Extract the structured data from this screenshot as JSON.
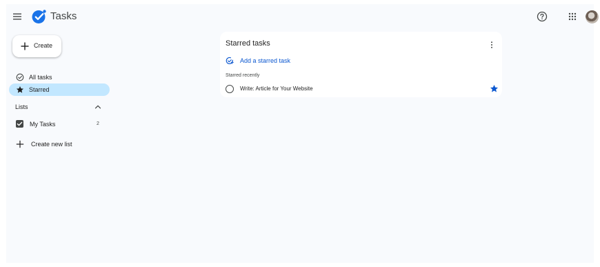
{
  "header": {
    "app_title": "Tasks",
    "menu_icon": "hamburger-menu-icon",
    "logo_icon": "tasks-logo-icon",
    "help_icon": "help-circle-icon",
    "apps_icon": "apps-grid-icon",
    "avatar": "user-avatar"
  },
  "sidebar": {
    "create_label": "Create",
    "nav": [
      {
        "label": "All tasks",
        "icon": "check-circle-icon",
        "active": false
      },
      {
        "label": "Starred",
        "icon": "star-icon",
        "active": true
      }
    ],
    "lists_header": "Lists",
    "lists": [
      {
        "label": "My Tasks",
        "count": "2",
        "checked": true
      }
    ],
    "create_list_label": "Create new list"
  },
  "main": {
    "card_title": "Starred tasks",
    "add_task_label": "Add a starred task",
    "section_label": "Starred recently",
    "tasks": [
      {
        "title": "Write: Article for Your Website",
        "starred": true
      }
    ]
  },
  "colors": {
    "accent": "#0b57d0",
    "active_nav_bg": "#c2e7ff",
    "page_bg": "#f8fafd",
    "logo_blue": "#1a73e8"
  }
}
